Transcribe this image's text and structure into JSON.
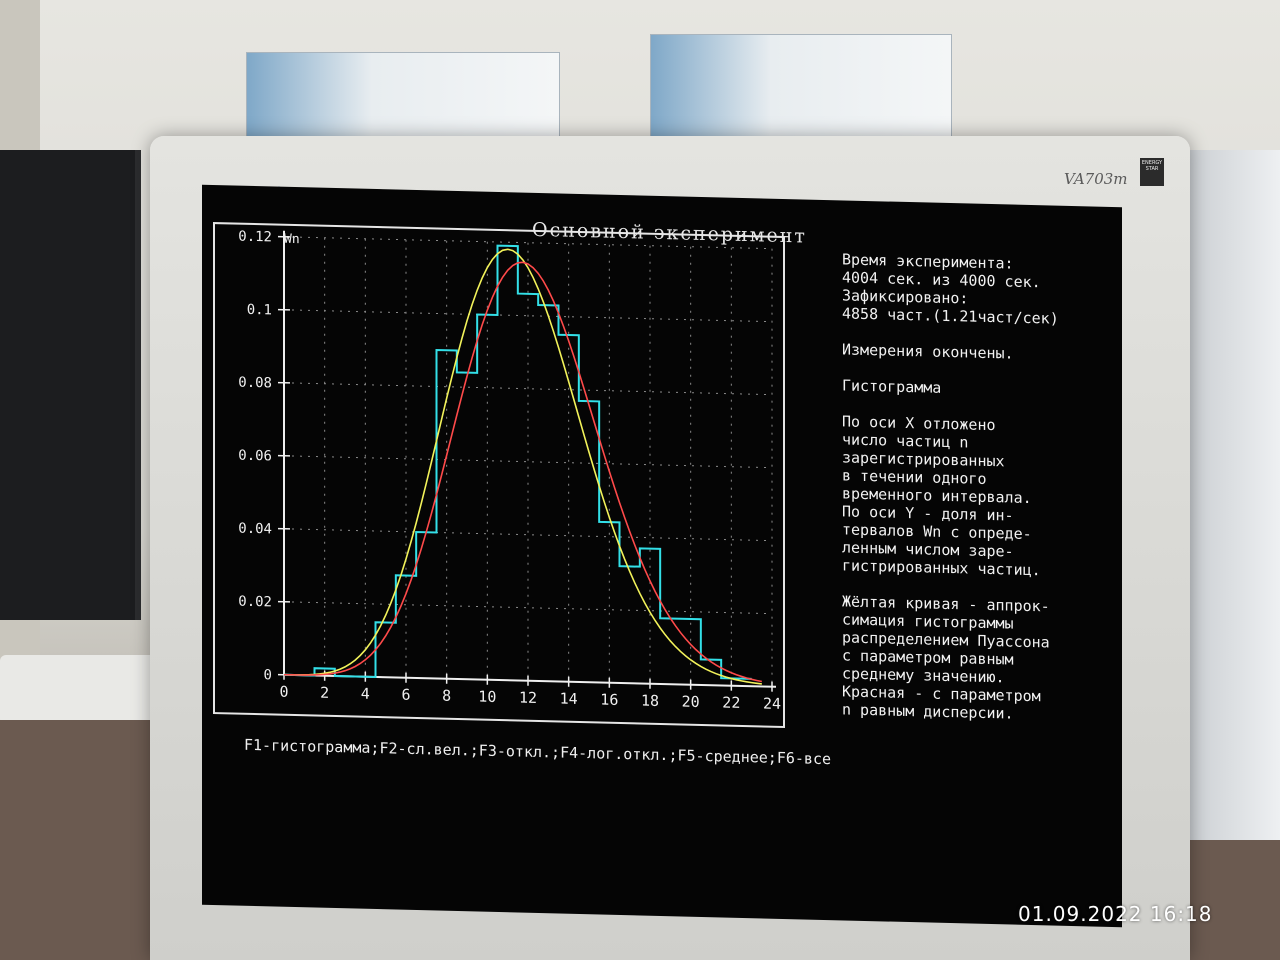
{
  "screen": {
    "title": "Основной эксперимент",
    "info_lines": [
      "Время эксперимента:",
      "4004 сек. из 4000 сек.",
      "Зафиксировано:",
      "4858 част.(1.21част/сек)",
      "",
      "Измерения окончены.",
      "",
      "Гистограмма",
      "",
      "По оси X отложено",
      "число частиц n",
      "зарегистрированных",
      "в течении одного",
      "временного интервала.",
      "По оси Y - доля ин-",
      "тервалов Wn с опреде-",
      "ленным числом заре-",
      "гистрированных частиц.",
      "",
      "Жёлтая кривая - аппрок-",
      "симация гистограммы",
      "распределением Пуассона",
      "с параметром равным",
      "среднему значению.",
      "Красная - с параметром",
      "n равным дисперсии."
    ],
    "function_keys": "F1-гистограмма;F2-сл.вел.;F3-откл.;F4-лог.откл.;F5-среднее;F6-все"
  },
  "monitor": {
    "model": "VA703m",
    "energy_star": "ENERGY STAR"
  },
  "photo_timestamp": "01.09.2022  16:18",
  "chart_data": {
    "type": "line",
    "ylabel": "Wn",
    "xlim": [
      0,
      24
    ],
    "ylim": [
      0,
      0.12
    ],
    "x_ticks": [
      "0",
      "2",
      "4",
      "6",
      "8",
      "10",
      "12",
      "14",
      "16",
      "18",
      "20",
      "22",
      "24"
    ],
    "y_ticks": [
      "0",
      "0.02",
      "0.04",
      "0.06",
      "0.08",
      "0.1",
      "0.12"
    ],
    "grid": true,
    "histogram": {
      "color": "#33e0e8",
      "bins": [
        {
          "x0": 0,
          "x1": 1.5,
          "value": 0.0
        },
        {
          "x0": 1.5,
          "x1": 2.5,
          "value": 0.002
        },
        {
          "x0": 2.5,
          "x1": 4.5,
          "value": 0.0
        },
        {
          "x0": 4.5,
          "x1": 5.5,
          "value": 0.015
        },
        {
          "x0": 5.5,
          "x1": 6.5,
          "value": 0.028
        },
        {
          "x0": 6.5,
          "x1": 7.5,
          "value": 0.04
        },
        {
          "x0": 7.5,
          "x1": 8.5,
          "value": 0.09
        },
        {
          "x0": 8.5,
          "x1": 9.5,
          "value": 0.084
        },
        {
          "x0": 9.5,
          "x1": 10.5,
          "value": 0.1
        },
        {
          "x0": 10.5,
          "x1": 11.5,
          "value": 0.119
        },
        {
          "x0": 11.5,
          "x1": 12.5,
          "value": 0.106
        },
        {
          "x0": 12.5,
          "x1": 13.5,
          "value": 0.103
        },
        {
          "x0": 13.5,
          "x1": 14.5,
          "value": 0.095
        },
        {
          "x0": 14.5,
          "x1": 15.5,
          "value": 0.077
        },
        {
          "x0": 15.5,
          "x1": 16.5,
          "value": 0.044
        },
        {
          "x0": 16.5,
          "x1": 17.5,
          "value": 0.032
        },
        {
          "x0": 17.5,
          "x1": 18.5,
          "value": 0.037
        },
        {
          "x0": 18.5,
          "x1": 20.5,
          "value": 0.018
        },
        {
          "x0": 20.5,
          "x1": 21.5,
          "value": 0.007
        },
        {
          "x0": 21.5,
          "x1": 23.0,
          "value": 0.002
        }
      ]
    },
    "series": [
      {
        "color": "#f2f25a",
        "lambda": 11.5
      },
      {
        "color": "#ff4a4a",
        "lambda": 12.2
      }
    ]
  }
}
